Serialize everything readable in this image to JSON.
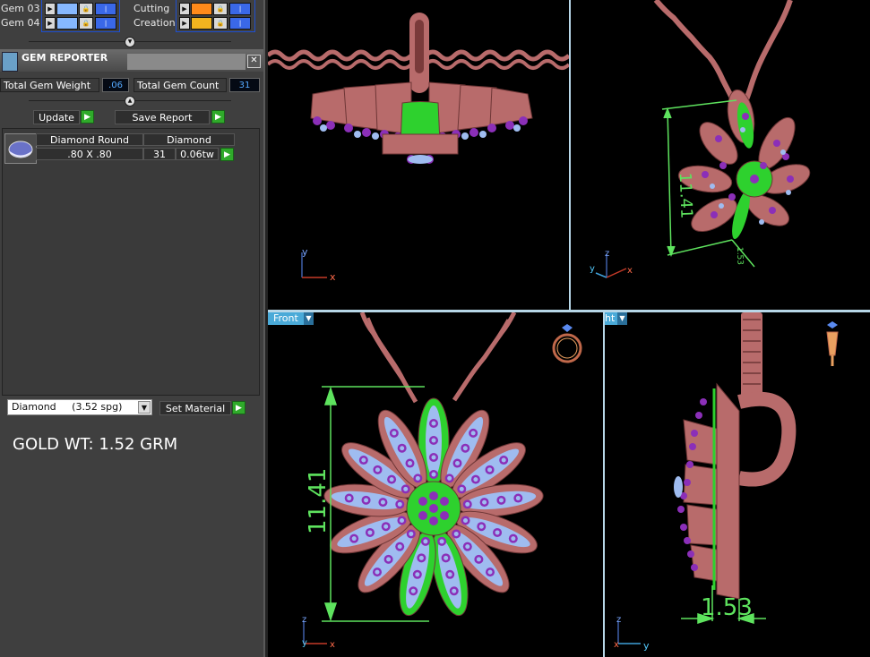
{
  "layers": [
    {
      "name": "Gem 03",
      "color": "#86b8ff"
    },
    {
      "name": "Gem 04",
      "color": "#86b8ff"
    },
    {
      "name": "Cutting",
      "color": "#ff8a1a"
    },
    {
      "name": "Creation",
      "color": "#f1b31f"
    }
  ],
  "panel": {
    "title": "GEM REPORTER",
    "close": "✕",
    "total_weight_label": "Total Gem Weight",
    "total_weight_value": ".06",
    "total_count_label": "Total Gem Count",
    "total_count_value": "31",
    "update_label": "Update",
    "save_report_label": "Save Report",
    "play_glyph": "▶"
  },
  "report": {
    "headers": [
      "Diamond Round",
      "Diamond"
    ],
    "row": {
      "size": ".80 X .80",
      "count": "31",
      "weight": "0.06tw"
    }
  },
  "material": {
    "selected": "Diamond     (3.52 spg)",
    "arrow": "▼",
    "set_label": "Set Material"
  },
  "gold_weight": "GOLD WT: 1.52 GRM",
  "viewports": {
    "bottom_left_tab": "Front",
    "bottom_right_tab": "ht",
    "tab_arrow": "▼",
    "dims": {
      "top_right_height": "11.41",
      "top_right_depth": "1.53",
      "front_height": "11.41",
      "side_depth": "1.53"
    },
    "axes": {
      "top_left": [
        "y",
        "x"
      ],
      "top_right": [
        "z",
        "y",
        "x"
      ],
      "bottom_left": [
        "z",
        "y",
        "x"
      ],
      "bottom_right": [
        "z",
        "x",
        "y"
      ]
    }
  },
  "colors": {
    "metal": "#b86b6b",
    "metal_dark": "#6e3636",
    "gem": "#9fbcf0",
    "prong": "#8b2fb8",
    "green": "#2ed12e",
    "dim_line": "#5ee35e"
  }
}
